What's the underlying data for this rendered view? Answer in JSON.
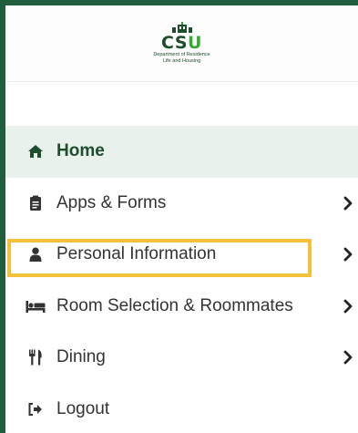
{
  "brand": {
    "logo_text_cs": "CS",
    "logo_text_u": "U",
    "sub_line1": "Department of Residence",
    "sub_line2": "Life and Housing"
  },
  "nav": {
    "items": [
      {
        "label": "Home",
        "icon": "home-icon",
        "active": true,
        "has_chevron": false
      },
      {
        "label": "Apps & Forms",
        "icon": "clipboard-icon",
        "active": false,
        "has_chevron": true
      },
      {
        "label": "Personal Information",
        "icon": "user-icon",
        "active": false,
        "has_chevron": true,
        "highlighted": true
      },
      {
        "label": "Room Selection & Roommates",
        "icon": "bed-icon",
        "active": false,
        "has_chevron": true
      },
      {
        "label": "Dining",
        "icon": "utensils-icon",
        "active": false,
        "has_chevron": true
      },
      {
        "label": "Logout",
        "icon": "sign-out-icon",
        "active": false,
        "has_chevron": false
      }
    ]
  },
  "colors": {
    "outer_background": "#1f5d3c",
    "active_background": "#e8f1ec",
    "active_text": "#1e4d2b",
    "highlight_border": "#f3c13a"
  }
}
